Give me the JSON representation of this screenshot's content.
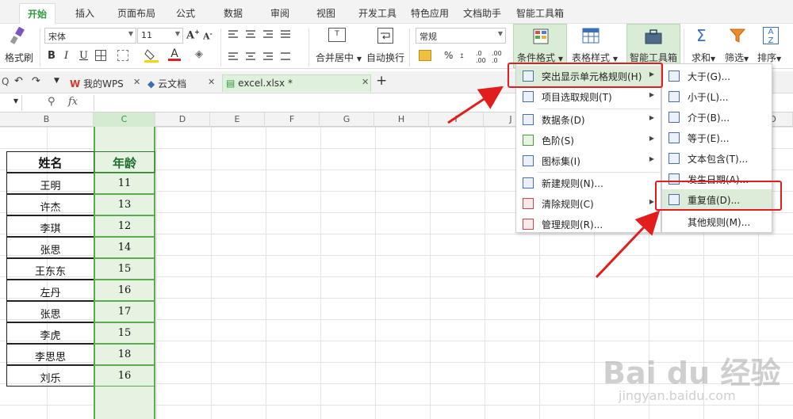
{
  "tabs": [
    "开始",
    "插入",
    "页面布局",
    "公式",
    "数据",
    "审阅",
    "视图",
    "开发工具",
    "特色应用",
    "文档助手",
    "智能工具箱"
  ],
  "ribbon": {
    "format_painter": "格式刷",
    "font_name": "宋体",
    "font_size": "11",
    "merge_center": "合并居中",
    "wrap_text": "自动换行",
    "number_format": "常规",
    "percent": "%",
    "conditional_format": "条件格式",
    "table_style": "表格样式",
    "smart_toolbox": "智能工具箱",
    "sum": "求和",
    "filter": "筛选",
    "sort": "排序",
    "bold": "B",
    "italic": "I",
    "underline": "U"
  },
  "docbar": {
    "my_wps": "我的WPS",
    "cloud_doc": "云文档",
    "file_tab": "excel.xlsx *",
    "add": "+"
  },
  "formula_bar": {
    "fx": "fx"
  },
  "columns": [
    "B",
    "C",
    "D",
    "E",
    "F",
    "G",
    "H",
    "I",
    "J",
    "O"
  ],
  "table": {
    "header_name": "姓名",
    "header_age": "年龄",
    "rows": [
      {
        "name": "王明",
        "age": "11"
      },
      {
        "name": "许杰",
        "age": "13"
      },
      {
        "name": "李琪",
        "age": "12"
      },
      {
        "name": "张思",
        "age": "14"
      },
      {
        "name": "王东东",
        "age": "15"
      },
      {
        "name": "左丹",
        "age": "16"
      },
      {
        "name": "张思",
        "age": "17"
      },
      {
        "name": "李虎",
        "age": "15"
      },
      {
        "name": "李思思",
        "age": "18"
      },
      {
        "name": "刘乐",
        "age": "16"
      }
    ]
  },
  "cond_menu": {
    "items": [
      "突出显示单元格规则(H)",
      "项目选取规则(T)",
      "数据条(D)",
      "色阶(S)",
      "图标集(I)",
      "新建规则(N)...",
      "清除规则(C)",
      "管理规则(R)..."
    ]
  },
  "sub_menu": {
    "items": [
      "大于(G)...",
      "小于(L)...",
      "介于(B)...",
      "等于(E)...",
      "文本包含(T)...",
      "发生日期(A)...",
      "重复值(D)...",
      "其他规则(M)..."
    ]
  },
  "watermark": {
    "logo": "Bai du 经验",
    "url": "jingyan.baidu.com"
  },
  "colors": {
    "accent_green": "#2e9a3c",
    "highlight_red": "#e21d1d",
    "selected_column": "#e6f3e3"
  }
}
